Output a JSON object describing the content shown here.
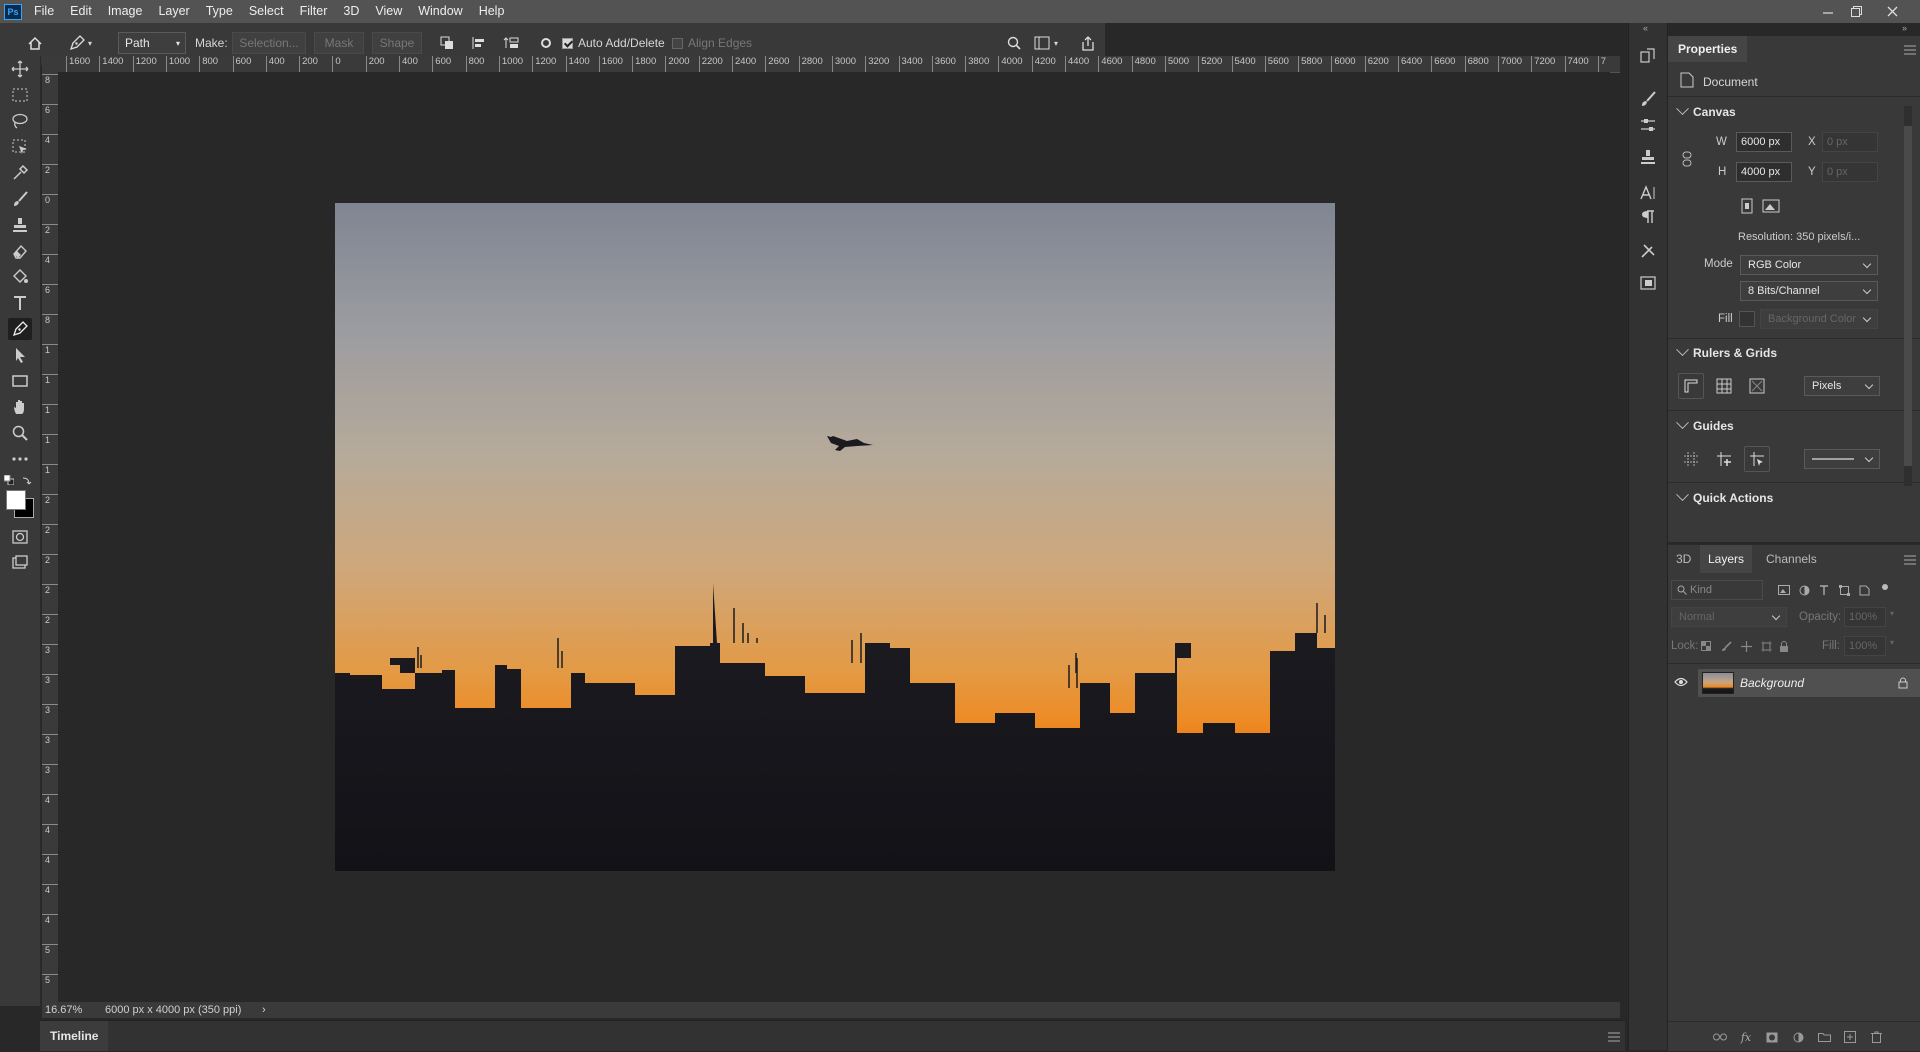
{
  "app": {
    "logo": "Ps",
    "menus": [
      "File",
      "Edit",
      "Image",
      "Layer",
      "Type",
      "Select",
      "Filter",
      "3D",
      "View",
      "Window",
      "Help"
    ]
  },
  "options_bar": {
    "mode_value": "Path",
    "make_label": "Make:",
    "selection_label": "Selection...",
    "mask_label": "Mask",
    "shape_label": "Shape",
    "auto_add_delete_label": "Auto Add/Delete",
    "auto_add_delete_checked": true,
    "align_edges_label": "Align Edges",
    "align_edges_checked": false
  },
  "ruler": {
    "horizontal": [
      "1600",
      "1400",
      "1200",
      "1000",
      "800",
      "600",
      "400",
      "200",
      "0",
      "200",
      "400",
      "600",
      "800",
      "1000",
      "1200",
      "1400",
      "1600",
      "1800",
      "2000",
      "2200",
      "2400",
      "2600",
      "2800",
      "3000",
      "3200",
      "3400",
      "3600",
      "3800",
      "4000",
      "4200",
      "4400",
      "4600",
      "4800",
      "5000",
      "5200",
      "5400",
      "5600",
      "5800",
      "6000",
      "6200",
      "6400",
      "6600",
      "6800",
      "7000",
      "7200",
      "7400",
      "7"
    ],
    "vertical": [
      "8",
      "6",
      "4",
      "2",
      "0",
      "2",
      "4",
      "6",
      "8",
      "1",
      "1",
      "1",
      "1",
      "1",
      "2",
      "2",
      "2",
      "2",
      "2",
      "3",
      "3",
      "3",
      "3",
      "3",
      "4",
      "4",
      "4",
      "4",
      "4",
      "5",
      "5"
    ]
  },
  "status": {
    "zoom": "16.67%",
    "doc_info": "6000 px x 4000 px (350 ppi)",
    "expand_glyph": "›"
  },
  "timeline": {
    "label": "Timeline"
  },
  "properties": {
    "tab": "Properties",
    "doc_label": "Document",
    "canvas": {
      "title": "Canvas",
      "w_label": "W",
      "w_value": "6000 px",
      "h_label": "H",
      "h_value": "4000 px",
      "x_label": "X",
      "x_placeholder": "0 px",
      "y_label": "Y",
      "y_placeholder": "0 px",
      "resolution": "Resolution: 350 pixels/i...",
      "mode_label": "Mode",
      "mode_value": "RGB Color",
      "depth_value": "8 Bits/Channel",
      "fill_label": "Fill",
      "fill_value": "Background Color"
    },
    "rulers_grids": {
      "title": "Rulers & Grids",
      "units_value": "Pixels"
    },
    "guides": {
      "title": "Guides"
    },
    "quick_actions": {
      "title": "Quick Actions"
    }
  },
  "layers_panel": {
    "tabs": [
      "3D",
      "Layers",
      "Channels"
    ],
    "active_tab": "Layers",
    "kind_placeholder": "Kind",
    "blend_mode": "Normal",
    "opacity_label": "Opacity:",
    "opacity_value": "100%",
    "lock_label": "Lock:",
    "fill_label": "Fill:",
    "fill_value": "100%",
    "layers": [
      {
        "name": "Background",
        "visible": true,
        "locked": true
      }
    ]
  },
  "colors": {
    "accent": "#31a8ff",
    "menubar": "#535353",
    "panel": "#393939",
    "workspace": "#282828"
  }
}
